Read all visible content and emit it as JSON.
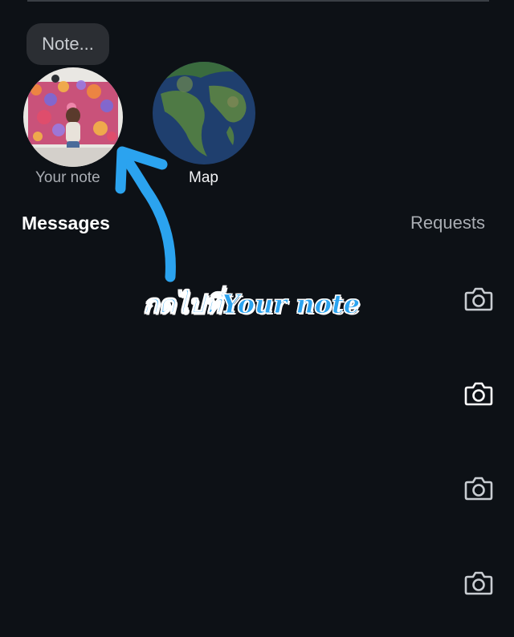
{
  "notes": {
    "bubble_text": "Note...",
    "items": [
      {
        "label": "Your note"
      },
      {
        "label": "Map"
      }
    ]
  },
  "header": {
    "title": "Messages",
    "requests_label": "Requests"
  },
  "annotation": {
    "text": "กดไปที่Your note",
    "color": "#2ba3ef"
  },
  "message_rows": [
    {
      "icon": "camera-icon"
    },
    {
      "icon": "camera-icon"
    },
    {
      "icon": "camera-icon"
    },
    {
      "icon": "camera-icon"
    }
  ],
  "colors": {
    "background": "#0d1116",
    "annotation_blue": "#2ba3ef"
  }
}
